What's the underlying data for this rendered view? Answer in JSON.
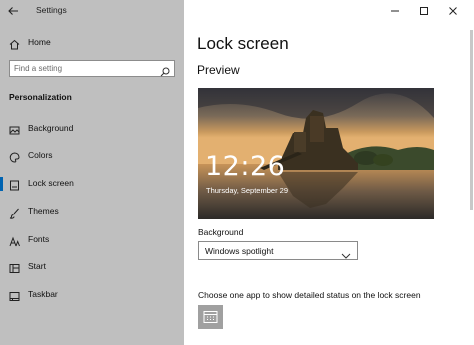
{
  "window": {
    "title": "Settings",
    "controls": [
      "minimize-icon",
      "maximize-icon",
      "close-icon"
    ]
  },
  "sidebar": {
    "home_label": "Home",
    "search_placeholder": "Find a setting",
    "section_title": "Personalization",
    "items": [
      {
        "label": "Background",
        "icon": "picture-icon",
        "active": false
      },
      {
        "label": "Colors",
        "icon": "palette-icon",
        "active": false
      },
      {
        "label": "Lock screen",
        "icon": "lock-screen-icon",
        "active": true
      },
      {
        "label": "Themes",
        "icon": "brush-icon",
        "active": false
      },
      {
        "label": "Fonts",
        "icon": "font-icon",
        "active": false
      },
      {
        "label": "Start",
        "icon": "start-icon",
        "active": false
      },
      {
        "label": "Taskbar",
        "icon": "taskbar-icon",
        "active": false
      }
    ],
    "accent_color": "#0063b1"
  },
  "main": {
    "title": "Lock screen",
    "preview_label": "Preview",
    "preview_time": "12:26",
    "preview_date": "Thursday, September 29",
    "background_label": "Background",
    "background_value": "Windows spotlight",
    "status_label": "Choose one app to show detailed status on the lock screen",
    "status_app_icon": "calendar-icon"
  }
}
